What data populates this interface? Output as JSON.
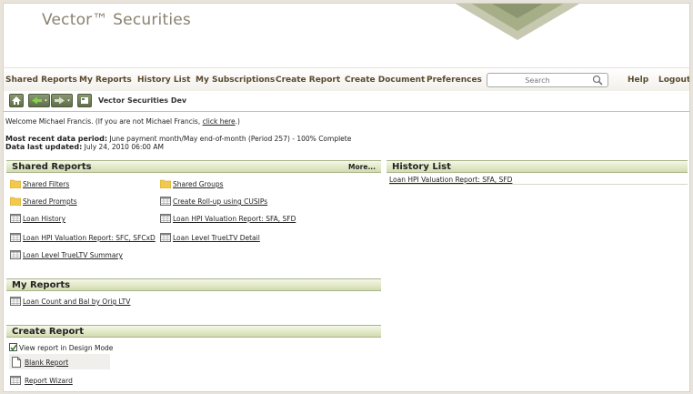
{
  "brand": {
    "name": "Vector™ Securities"
  },
  "nav": {
    "items": [
      {
        "label": "Shared Reports"
      },
      {
        "label": "My Reports"
      },
      {
        "label": "History List"
      },
      {
        "label": "My Subscriptions"
      },
      {
        "label": "Create Report"
      },
      {
        "label": "Create Document"
      },
      {
        "label": "Preferences"
      }
    ],
    "search_placeholder": "Search",
    "help": "Help",
    "logout": "Logout"
  },
  "toolbar": {
    "project": "Vector Securities Dev"
  },
  "welcome": {
    "prefix": "Welcome Michael Francis. (If you are not Michael Francis, ",
    "link": "click here",
    "suffix": ".)"
  },
  "data_period": {
    "label": "Most recent data period:",
    "value": " June payment month/May end-of-month (Period 257) - 100% Complete",
    "updated_label": "Data last updated:",
    "updated_value": " July 24, 2010 06:00 AM"
  },
  "shared_reports": {
    "title": "Shared Reports",
    "more": "More...",
    "left_items": [
      {
        "label": "Shared Filters",
        "icon": "folder-icon"
      },
      {
        "label": "Shared Prompts",
        "icon": "folder-icon"
      },
      {
        "label": "Loan History",
        "icon": "report-grid-icon"
      },
      {
        "label": "Loan HPI Valuation Report: SFC, SFCxD",
        "icon": "report-grid-icon"
      },
      {
        "label": "Loan Level TrueLTV Summary",
        "icon": "report-grid-icon"
      }
    ],
    "right_items": [
      {
        "label": "Shared Groups",
        "icon": "folder-icon"
      },
      {
        "label": "Create Roll-up using CUSIPs",
        "icon": "report-grid-icon"
      },
      {
        "label": "Loan HPI Valuation Report: SFA, SFD",
        "icon": "report-grid-icon"
      },
      {
        "label": "Loan Level TrueLTV Detail",
        "icon": "report-grid-icon"
      }
    ]
  },
  "history_list": {
    "title": "History List",
    "items": [
      {
        "label": "Loan HPI Valuation Report: SFA, SFD"
      }
    ]
  },
  "my_reports": {
    "title": "My Reports",
    "items": [
      {
        "label": "Loan Count and Bal by Orig LTV",
        "icon": "report-grid-icon"
      }
    ]
  },
  "create_report": {
    "title": "Create Report",
    "design_mode_label": "View report in Design Mode",
    "design_mode_checked": true,
    "items": [
      {
        "label": "Blank Report",
        "icon": "blank-page-icon"
      },
      {
        "label": "Report Wizard",
        "icon": "report-grid-icon"
      }
    ]
  },
  "colors": {
    "nav_text": "#5a4a30",
    "panel_header": "#d2dbb0",
    "toolbar_button": "#6b7a52",
    "folder": "#f2c94c"
  }
}
